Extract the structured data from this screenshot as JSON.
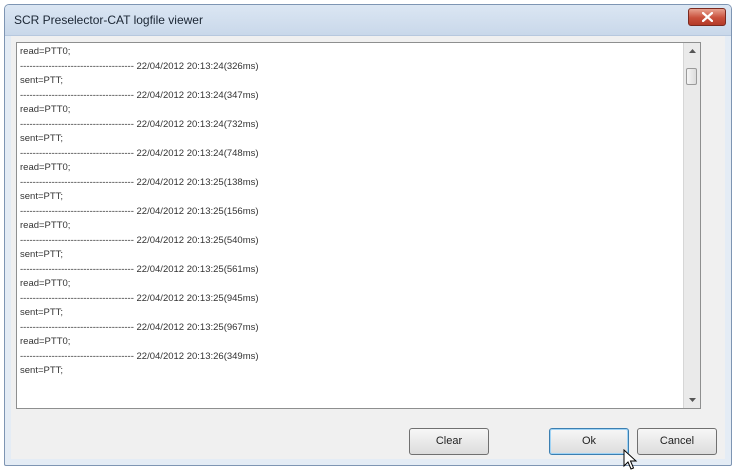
{
  "window": {
    "title": "SCR Preselector-CAT logfile viewer"
  },
  "log": {
    "lines": [
      "read=PTT0;",
      "------------------------------------ 22/04/2012 20:13:24(326ms)",
      "sent=PTT;",
      "------------------------------------ 22/04/2012 20:13:24(347ms)",
      "read=PTT0;",
      "------------------------------------ 22/04/2012 20:13:24(732ms)",
      "sent=PTT;",
      "------------------------------------ 22/04/2012 20:13:24(748ms)",
      "read=PTT0;",
      "------------------------------------ 22/04/2012 20:13:25(138ms)",
      "sent=PTT;",
      "------------------------------------ 22/04/2012 20:13:25(156ms)",
      "read=PTT0;",
      "------------------------------------ 22/04/2012 20:13:25(540ms)",
      "sent=PTT;",
      "------------------------------------ 22/04/2012 20:13:25(561ms)",
      "read=PTT0;",
      "------------------------------------ 22/04/2012 20:13:25(945ms)",
      "sent=PTT;",
      "------------------------------------ 22/04/2012 20:13:25(967ms)",
      "read=PTT0;",
      "------------------------------------ 22/04/2012 20:13:26(349ms)",
      "sent=PTT;"
    ]
  },
  "buttons": {
    "clear": "Clear",
    "ok": "Ok",
    "cancel": "Cancel"
  },
  "colors": {
    "close_button": "#c9503c",
    "title_bar": "#c9d8ea",
    "focus_border": "#3c7fb1"
  }
}
